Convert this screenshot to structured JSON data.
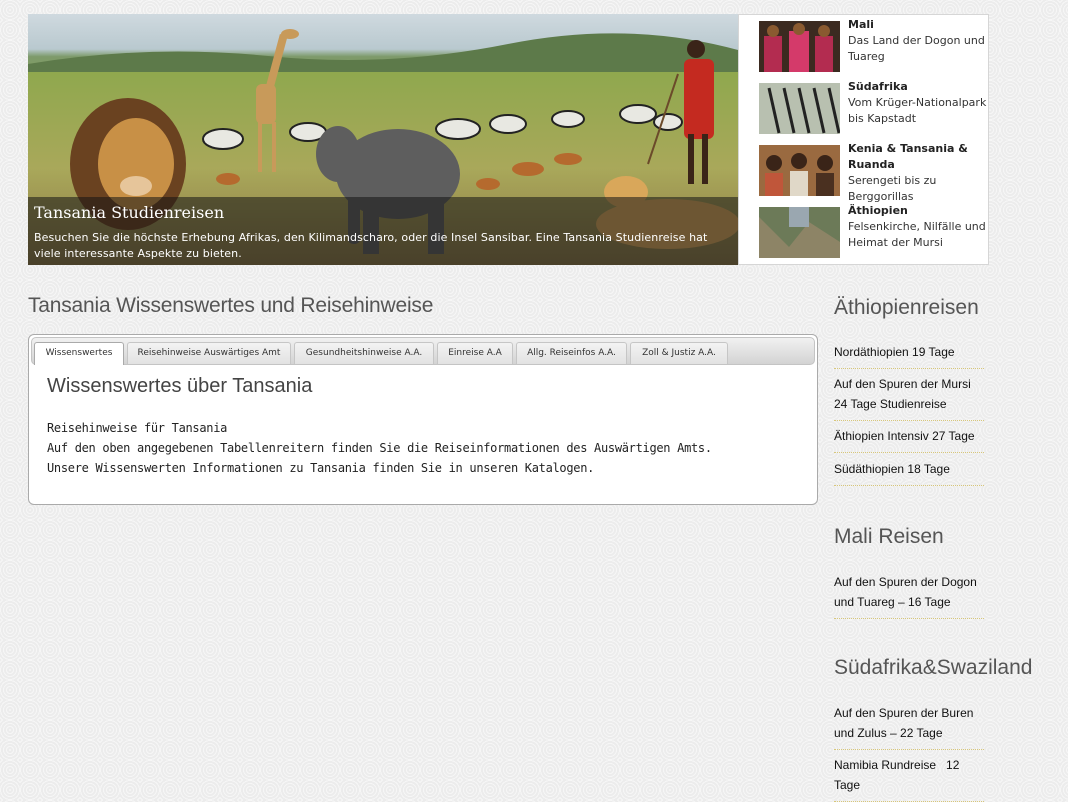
{
  "hero": {
    "title": "Tansania Studienreisen",
    "text": "Besuchen Sie die höchste Erhebung Afrikas, den Kilimandscharo, oder die Insel Sansibar. Eine Tansania Studienreise hat viele interessante Aspekte zu bieten."
  },
  "teasers": [
    {
      "title": "Mali",
      "sub": "Das Land der Dogon und Tuareg"
    },
    {
      "title": "Südafrika",
      "sub": "Vom Krüger-Nationalpark bis Kapstadt"
    },
    {
      "title": "Kenia & Tansania & Ruanda",
      "sub": "Serengeti bis zu Berggorillas"
    },
    {
      "title": "Äthiopien",
      "sub": "Felsenkirche, Nilfälle und Heimat der Mursi"
    }
  ],
  "main": {
    "title": "Tansania Wissenswertes und Reisehinweise",
    "tabs": [
      "Wissenswertes",
      "Reisehinweise Auswärtiges Amt",
      "Gesundheitshinweise A.A.",
      "Einreise A.A",
      "Allg. Reiseinfos A.A.",
      "Zoll & Justiz A.A."
    ],
    "content_title": "Wissenswertes über Tansania",
    "lines": [
      "Reisehinweise für Tansania",
      "Auf den oben angegebenen Tabellenreitern finden Sie die Reiseinformationen des Auswärtigen Amts.",
      "Unsere Wissenswerten Informationen zu Tansania finden Sie in unseren Katalogen."
    ]
  },
  "sidebar": {
    "sections": [
      {
        "heading": "Äthiopienreisen",
        "items": [
          "Nordäthiopien 19 Tage",
          "Auf den Spuren der Mursi 24 Tage Studienreise",
          "Äthiopien Intensiv 27 Tage",
          "Südäthiopien 18 Tage"
        ]
      },
      {
        "heading": "Mali Reisen",
        "items": [
          "Auf den Spuren der Dogon und Tuareg – 16 Tage"
        ]
      },
      {
        "heading": "Südafrika&Swaziland",
        "items": [
          "Auf den Spuren der Buren und Zulus – 22 Tage",
          "Namibia Rundreise   12 Tage"
        ]
      }
    ]
  }
}
